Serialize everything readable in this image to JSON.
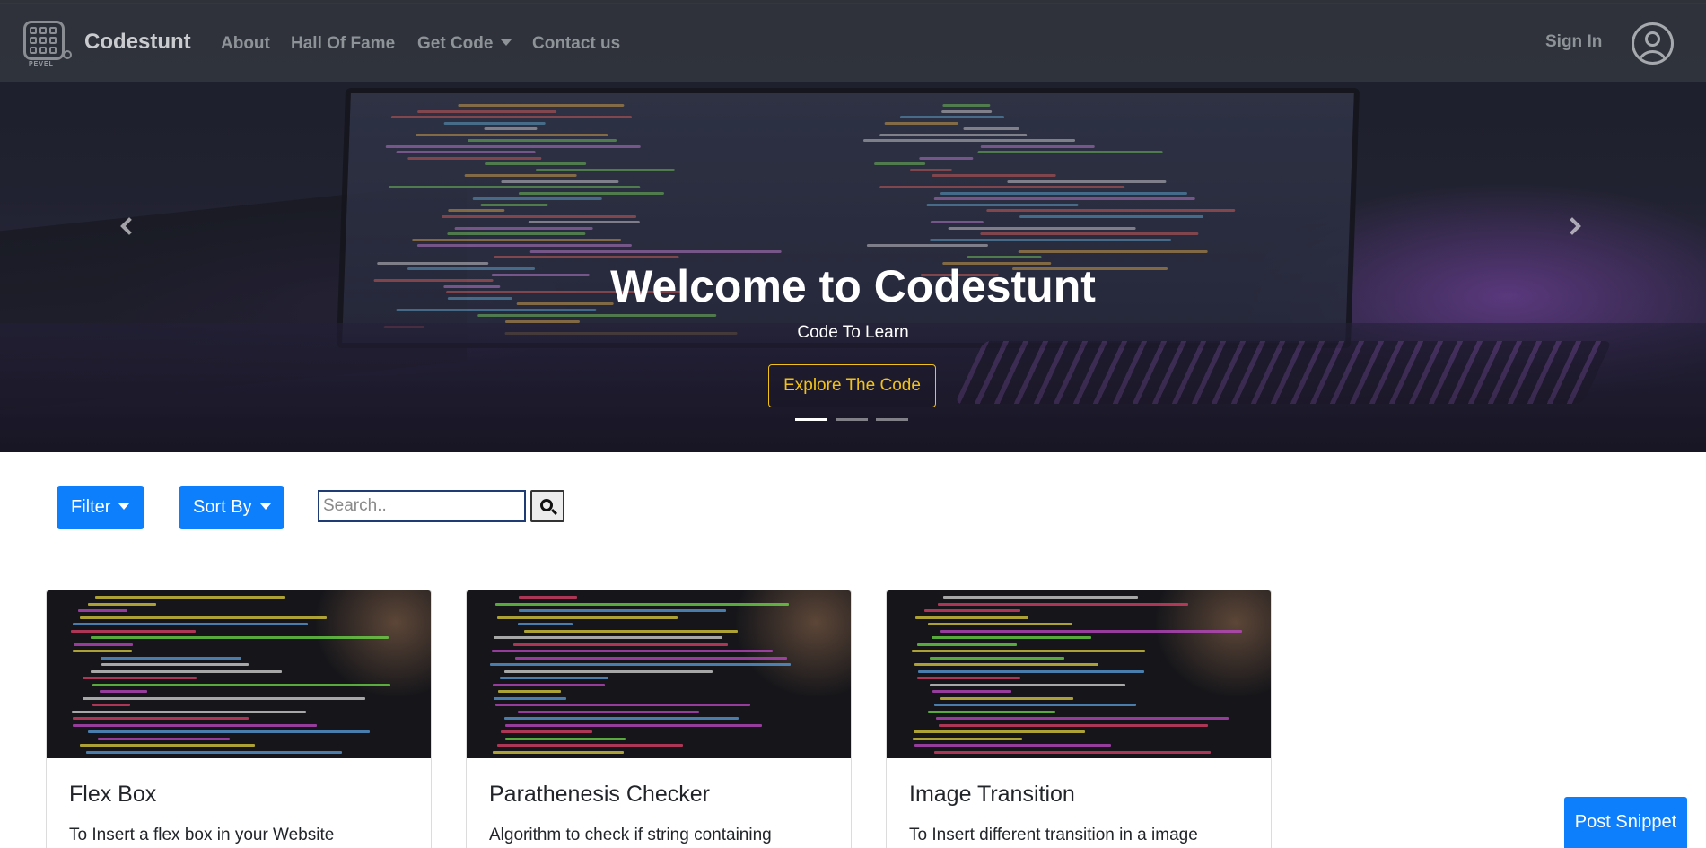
{
  "navbar": {
    "logo_caption": "PEVEL",
    "brand": "Codestunt",
    "links": [
      {
        "label": "About"
      },
      {
        "label": "Hall Of Fame"
      },
      {
        "label": "Get Code"
      },
      {
        "label": "Contact us"
      }
    ],
    "sign_in": "Sign In",
    "avatar_icon": "user-circle-icon"
  },
  "hero": {
    "title": "Welcome to Codestunt",
    "subtitle": "Code To Learn",
    "cta_label": "Explore The Code",
    "active_slide": 1,
    "slide_count": 3
  },
  "toolbar": {
    "filter_label": "Filter",
    "sort_label": "Sort By",
    "search_placeholder": "Search..",
    "search_icon": "search-icon"
  },
  "cards": [
    {
      "title": "Flex Box",
      "text": "To Insert a flex box in your Website"
    },
    {
      "title": "Parathenesis Checker",
      "text": "Algorithm to check if string containing"
    },
    {
      "title": "Image Transition",
      "text": "To Insert different transition in a image"
    }
  ],
  "post_snippet_label": "Post Snippet",
  "colors": {
    "primary_button": "#0d7efc",
    "cta_accent": "#f2c21b",
    "navbar_bg": "#343840"
  }
}
